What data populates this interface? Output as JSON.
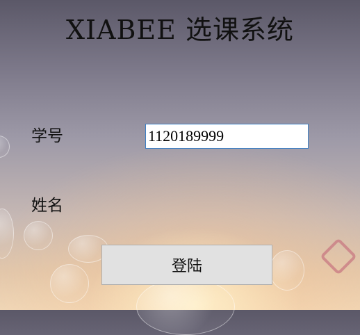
{
  "app": {
    "title": "XIABEE 选课系统"
  },
  "form": {
    "student_id_label": "学号",
    "student_id_value": "1120189999",
    "name_label": "姓名",
    "login_button": "登陆"
  }
}
